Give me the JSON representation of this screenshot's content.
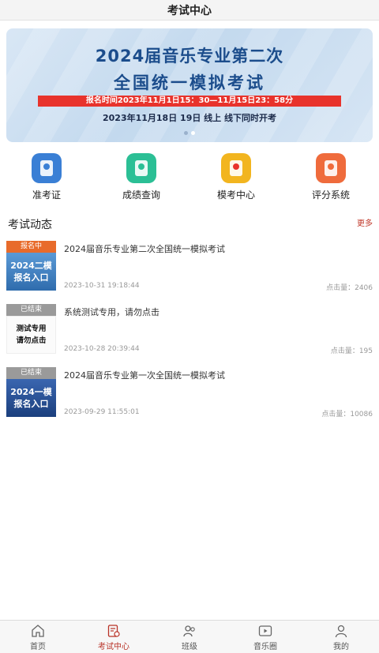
{
  "header": {
    "title": "考试中心"
  },
  "banner": {
    "title_line1": "2024届音乐专业第二次",
    "title_line2": "全国统一模拟考试",
    "registration": "报名时间2023年11月1日15：30—11月15日23：58分",
    "exam_time": "2023年11月18日  19日  线上  线下同时开考",
    "slides": 2,
    "active_slide": 1
  },
  "shortcuts": [
    {
      "label": "准考证",
      "icon": "admission-ticket-icon",
      "color": "#3a7fd5"
    },
    {
      "label": "成绩查询",
      "icon": "score-query-icon",
      "color": "#2bbf95"
    },
    {
      "label": "模考中心",
      "icon": "mock-exam-icon",
      "color": "#f2b51f"
    },
    {
      "label": "评分系统",
      "icon": "grading-system-icon",
      "color": "#ef6b3c"
    }
  ],
  "section": {
    "title": "考试动态",
    "more": "更多"
  },
  "exams": [
    {
      "status": "报名中",
      "thumb_lines": [
        "2024二模",
        "报名入口"
      ],
      "title": "2024届音乐专业第二次全国统一模拟考试",
      "date": "2023-10-31 19:18:44",
      "views": "点击量：2406"
    },
    {
      "status": "已结束",
      "thumb_lines": [
        "测试专用",
        "请勿点击"
      ],
      "title": "系统测试专用，请勿点击",
      "date": "2023-10-28 20:39:44",
      "views": "点击量：195"
    },
    {
      "status": "已结束",
      "thumb_lines": [
        "2024一模",
        "报名入口"
      ],
      "title": "2024届音乐专业第一次全国统一模拟考试",
      "date": "2023-09-29 11:55:01",
      "views": "点击量：10086"
    }
  ],
  "tabbar": [
    {
      "label": "首页",
      "icon": "home-icon"
    },
    {
      "label": "考试中心",
      "icon": "exam-center-icon",
      "active": true
    },
    {
      "label": "班级",
      "icon": "class-icon"
    },
    {
      "label": "音乐圈",
      "icon": "music-circle-icon"
    },
    {
      "label": "我的",
      "icon": "profile-icon"
    }
  ],
  "colors": {
    "accent": "#b83227",
    "status_open": "#e86b2b",
    "status_closed": "#9a9a9a"
  }
}
